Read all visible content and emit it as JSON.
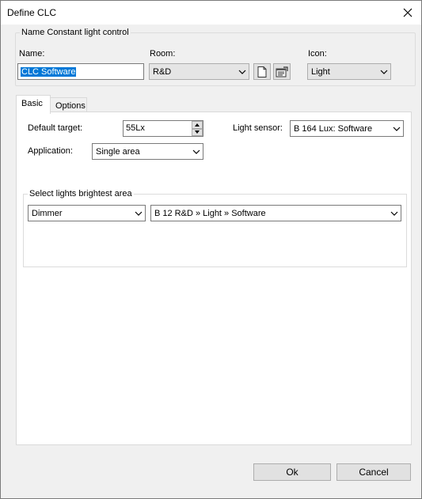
{
  "window": {
    "title": "Define CLC"
  },
  "name_group": {
    "title": "Name Constant light control",
    "name_label": "Name:",
    "name_value": "CLC Software",
    "room_label": "Room:",
    "room_value": "R&D",
    "icon_label": "Icon:",
    "icon_value": "Light"
  },
  "tabs": [
    {
      "label": "Basic",
      "active": true
    },
    {
      "label": "Options",
      "active": false
    }
  ],
  "basic": {
    "default_target_label": "Default target:",
    "default_target_value": "55Lx",
    "light_sensor_label": "Light sensor:",
    "light_sensor_value": "B 164  Lux: Software",
    "application_label": "Application:",
    "application_value": "Single area",
    "lights_group_title": "Select lights brightest area",
    "light_type_value": "Dimmer",
    "light_target_value": "B  12  R&D » Light » Software"
  },
  "buttons": {
    "ok": "Ok",
    "cancel": "Cancel"
  },
  "icons": {
    "close": "close-icon",
    "new_room": "new-document-icon",
    "room_properties": "properties-icon",
    "dropdown": "chevron-down-icon",
    "spin_up": "arrow-up-icon",
    "spin_down": "arrow-down-icon"
  }
}
